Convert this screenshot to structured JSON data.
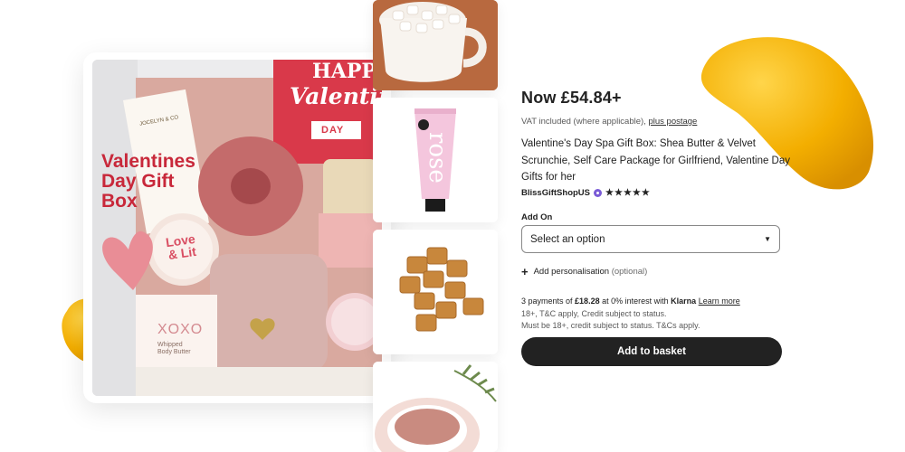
{
  "product": {
    "price": "Now £54.84+",
    "vat_text": "VAT included (where applicable),",
    "postage_link": "plus postage",
    "title": "Valentine's Day Spa Gift Box: Shea Butter & Velvet Scrunchie, Self Care Package for Girlfriend, Valentine Day Gifts for her",
    "shop_name": "BlissGiftShopUS",
    "rating_stars": "★★★★★",
    "add_on_label": "Add On",
    "select_value": "Select an option",
    "personalise_label": "Add personalisation",
    "personalise_optional": "(optional)",
    "klarna_prefix": "3 payments of",
    "klarna_amount": "£18.28",
    "klarna_middle": "at 0% interest with",
    "klarna_brand": "Klarna",
    "klarna_link": "Learn more",
    "note_1": "18+, T&C apply, Credit subject to status.",
    "note_2": "Must be 18+, credit subject to status. T&Cs apply.",
    "basket_button": "Add to basket"
  },
  "image_text": {
    "happy": "HAPPY",
    "valentine": "Valentine's",
    "day": "DAY",
    "box_title_1": "Valentines",
    "box_title_2": "Day Gift",
    "box_title_3": "Box",
    "candle_1": "Love",
    "candle_2": "& Lit",
    "xoxo": "XOXO",
    "butter_1": "Whipped",
    "butter_2": "Body Butter",
    "brand": "JOCELYN & CO",
    "tube": "rose"
  },
  "colors": {
    "accent_yellow": "#f5b800",
    "button_dark": "#222222",
    "brand_red": "#c8283a"
  }
}
